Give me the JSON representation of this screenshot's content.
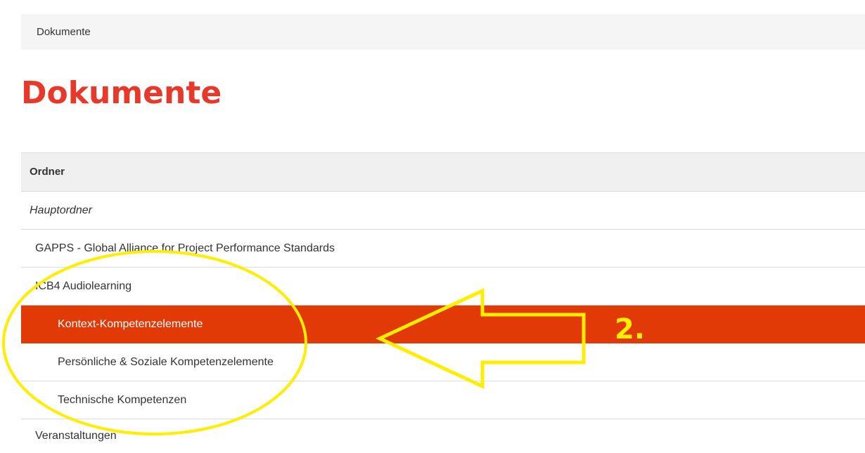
{
  "breadcrumb": {
    "current": "Dokumente"
  },
  "page": {
    "title": "Dokumente"
  },
  "table": {
    "header": "Ordner",
    "rows": [
      {
        "label": "Hauptordner",
        "level": 0
      },
      {
        "label": "GAPPS - Global Alliance for Project Performance Standards",
        "level": 1
      },
      {
        "label": "ICB4 Audiolearning",
        "level": 1
      },
      {
        "label": "Kontext-Kompetenzelemente",
        "level": 2,
        "selected": true
      },
      {
        "label": "Persönliche & Soziale Kompetenzelemente",
        "level": 2
      },
      {
        "label": "Technische Kompetenzen",
        "level": 2
      },
      {
        "label": "Veranstaltungen",
        "level": 1
      }
    ]
  },
  "annotation": {
    "step_label": "2.",
    "color": "#ffee00"
  },
  "colors": {
    "accent": "#e8382a",
    "selected_row": "#e13a06"
  }
}
